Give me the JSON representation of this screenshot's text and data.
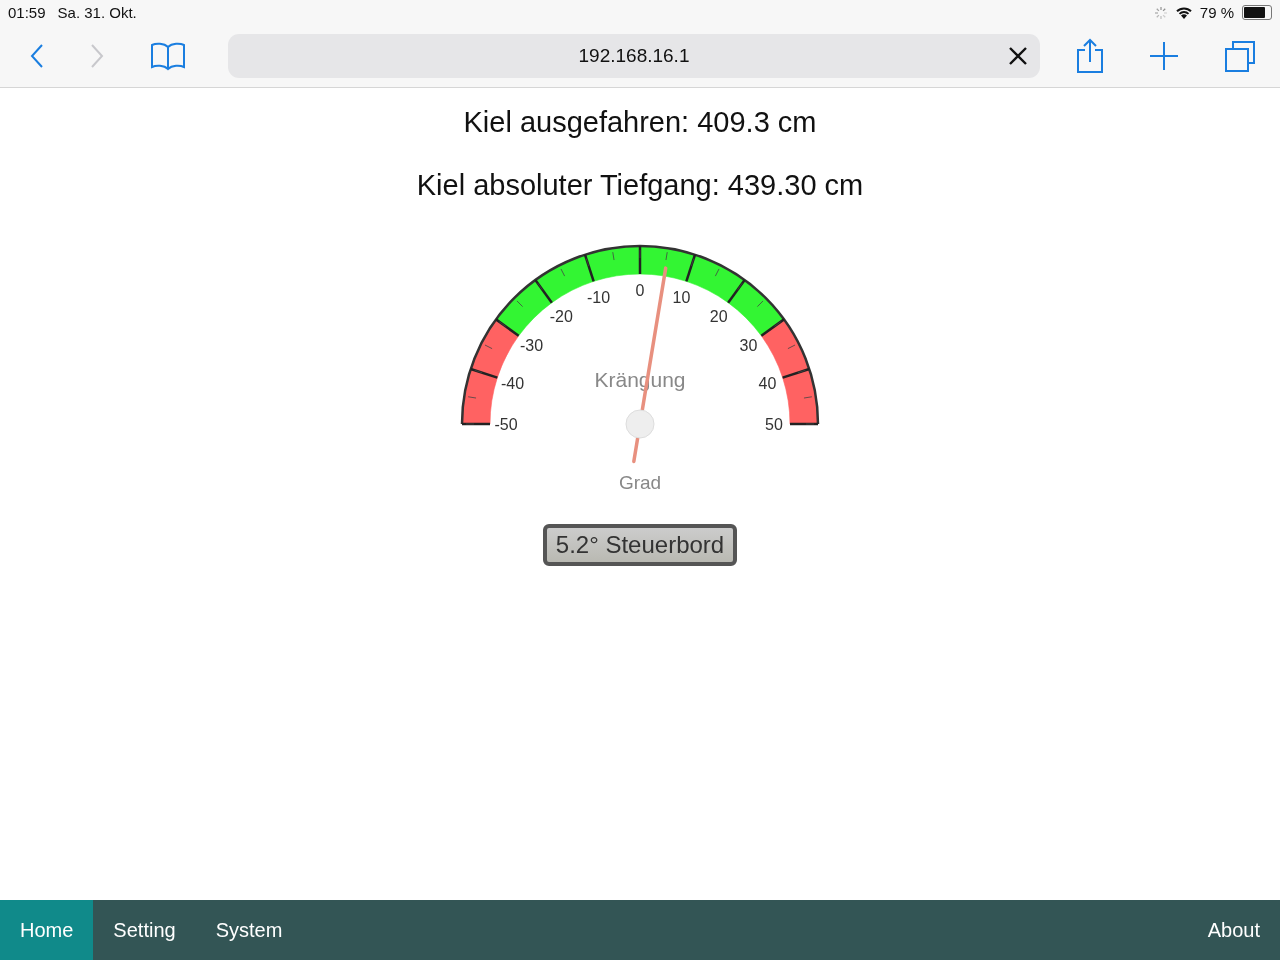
{
  "status_bar": {
    "time": "01:59",
    "date": "Sa. 31. Okt.",
    "battery_text": "79 %",
    "battery": {
      "level": 0.79
    }
  },
  "browser": {
    "url": "192.168.16.1",
    "forward_disabled": true
  },
  "readings": [
    "Kiel ausgefahren: 409.3 cm",
    "Kiel absoluter Tiefgang: 439.30 cm"
  ],
  "gauge": {
    "title": "Krängung",
    "unit": "Grad",
    "level": 0.552,
    "tick_labels": [
      "-50",
      "-40",
      "-30",
      "-20",
      "-10",
      "0",
      "10",
      "20",
      "30",
      "40",
      "50"
    ],
    "zones": [
      {
        "color": "#ff6262"
      },
      {
        "color": "#ff6262"
      },
      {
        "color": "#33f533"
      },
      {
        "color": "#33f533"
      },
      {
        "color": "#33f533"
      },
      {
        "color": "#33f533"
      },
      {
        "color": "#33f533"
      },
      {
        "color": "#33f533"
      },
      {
        "color": "#ff6262"
      },
      {
        "color": "#ff6262"
      }
    ],
    "value_text": "5.2° Steuerbord"
  },
  "nav": {
    "items": [
      {
        "label": "Home",
        "selected": true
      },
      {
        "label": "Setting",
        "selected": false
      },
      {
        "label": "System",
        "selected": false
      }
    ],
    "right": "About"
  }
}
